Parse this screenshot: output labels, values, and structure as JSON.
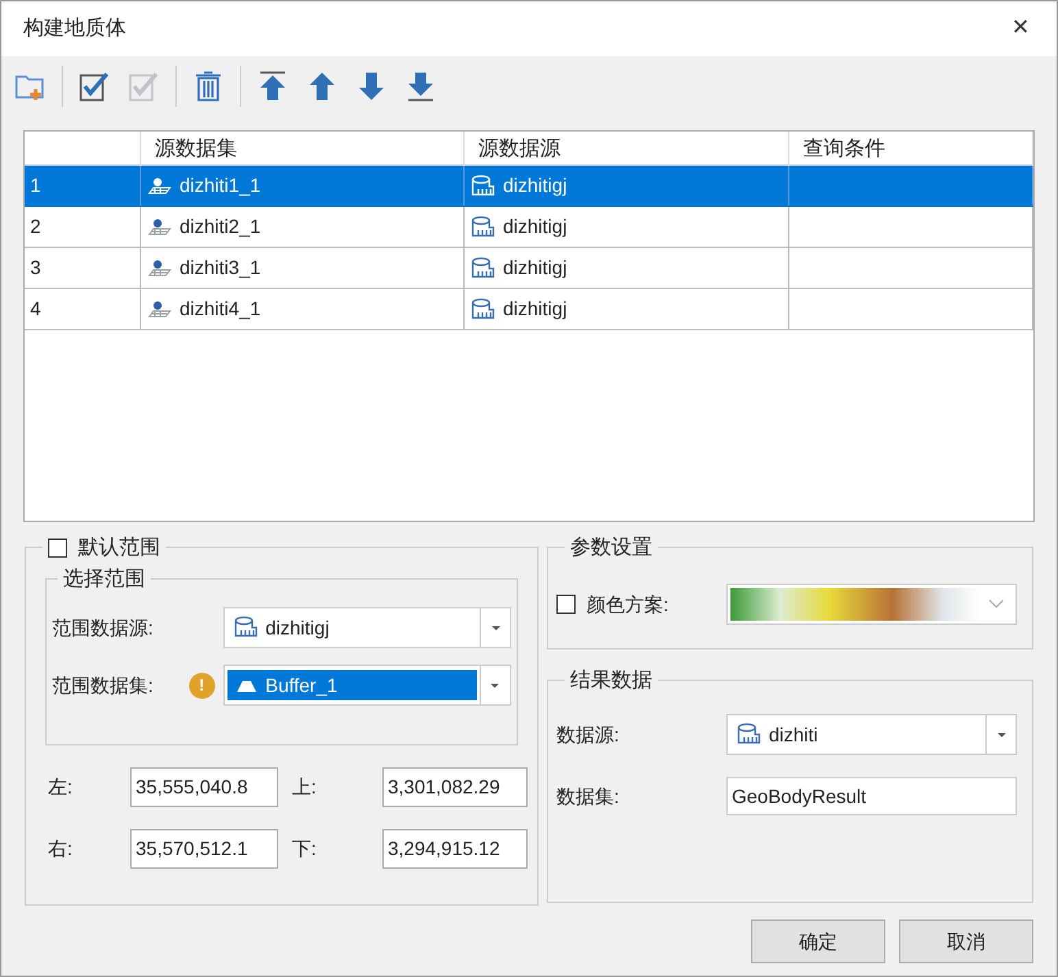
{
  "window": {
    "title": "构建地质体",
    "close": "✕"
  },
  "toolbar": [
    {
      "kind": "add-folder",
      "disabled": false
    },
    {
      "kind": "separator"
    },
    {
      "kind": "check-all",
      "disabled": false
    },
    {
      "kind": "check-all",
      "disabled": true
    },
    {
      "kind": "separator"
    },
    {
      "kind": "delete",
      "disabled": false
    },
    {
      "kind": "separator"
    },
    {
      "kind": "top",
      "disabled": false
    },
    {
      "kind": "up",
      "disabled": false
    },
    {
      "kind": "down",
      "disabled": false
    },
    {
      "kind": "bottom",
      "disabled": false
    }
  ],
  "table": {
    "columns": [
      "源数据集",
      "源数据源",
      "查询条件"
    ],
    "rows": [
      {
        "index": "1",
        "dataset": "dizhiti1_1",
        "datasource": "dizhitigj",
        "query": "",
        "selected": true
      },
      {
        "index": "2",
        "dataset": "dizhiti2_1",
        "datasource": "dizhitigj",
        "query": "",
        "selected": false
      },
      {
        "index": "3",
        "dataset": "dizhiti3_1",
        "datasource": "dizhitigj",
        "query": "",
        "selected": false
      },
      {
        "index": "4",
        "dataset": "dizhiti4_1",
        "datasource": "dizhitigj",
        "query": "",
        "selected": false
      }
    ]
  },
  "range": {
    "label": "默认范围",
    "checked": false,
    "select_group": "选择范围",
    "datasource_label": "范围数据源:",
    "datasource": "dizhitigj",
    "dataset_label": "范围数据集:",
    "dataset": "Buffer_1",
    "warning": "!",
    "bounds": [
      {
        "label": "左:",
        "value": "35,555,040.8"
      },
      {
        "label": "上:",
        "value": "3,301,082.29"
      },
      {
        "label": "右:",
        "value": "35,570,512.1"
      },
      {
        "label": "下:",
        "value": "3,294,915.12"
      }
    ]
  },
  "params": {
    "title": "参数设置",
    "color_scheme_label": "颜色方案:",
    "checked": false
  },
  "result": {
    "title": "结果数据",
    "datasource_label": "数据源:",
    "datasource": "dizhiti",
    "dataset_label": "数据集:",
    "dataset": "GeoBodyResult"
  },
  "buttons": [
    "确定",
    "取消"
  ]
}
